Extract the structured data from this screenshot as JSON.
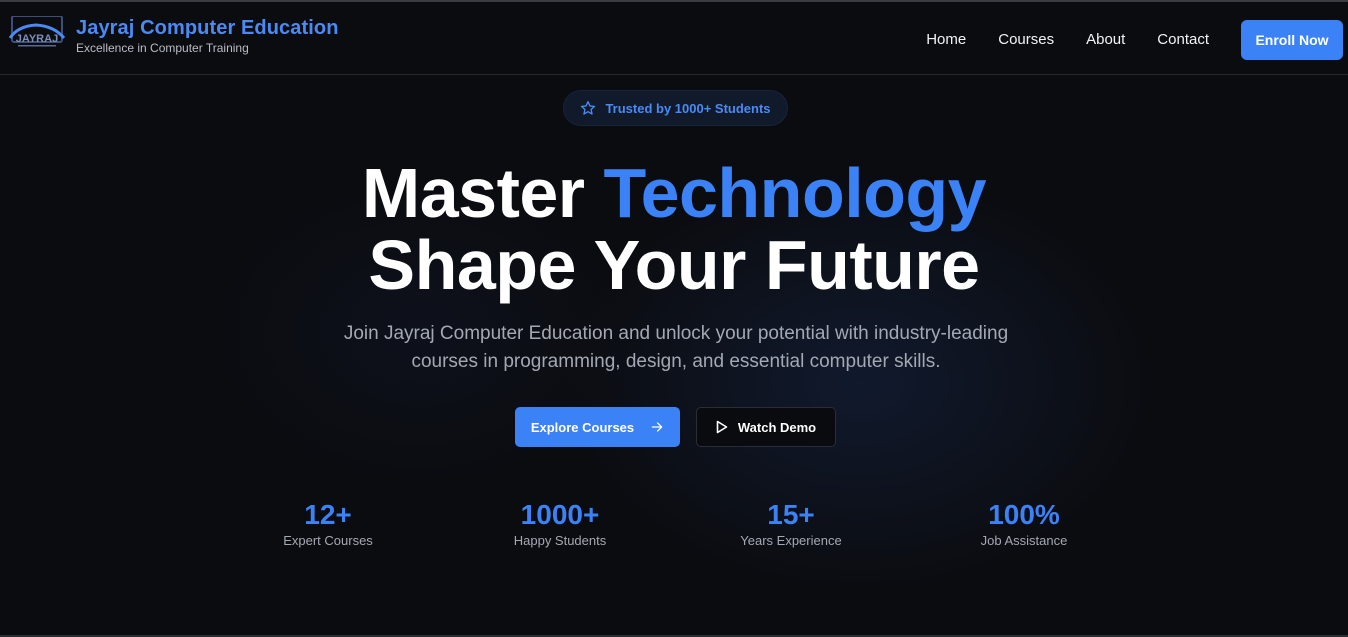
{
  "brand": {
    "logo_text": "JAYRAJ",
    "title": "Jayraj Computer Education",
    "subtitle": "Excellence in Computer Training"
  },
  "nav": {
    "items": [
      "Home",
      "Courses",
      "About",
      "Contact"
    ],
    "enroll_label": "Enroll Now"
  },
  "hero": {
    "badge": "Trusted by 1000+ Students",
    "headline_part1": "Master",
    "headline_accent": "Technology",
    "headline_line2": "Shape Your Future",
    "description": "Join Jayraj Computer Education and unlock your potential with industry-leading courses in programming, design, and essential computer skills.",
    "primary_cta": "Explore Courses",
    "secondary_cta": "Watch Demo"
  },
  "stats": [
    {
      "value": "12+",
      "label": "Expert Courses"
    },
    {
      "value": "1000+",
      "label": "Happy Students"
    },
    {
      "value": "15+",
      "label": "Years Experience"
    },
    {
      "value": "100%",
      "label": "Job Assistance"
    }
  ],
  "colors": {
    "accent": "#3b82f6",
    "background": "#0b0c10",
    "muted_text": "#a3a8b3"
  },
  "icons": {
    "badge": "star-icon",
    "primary_cta": "arrow-right-icon",
    "secondary_cta": "play-icon"
  }
}
